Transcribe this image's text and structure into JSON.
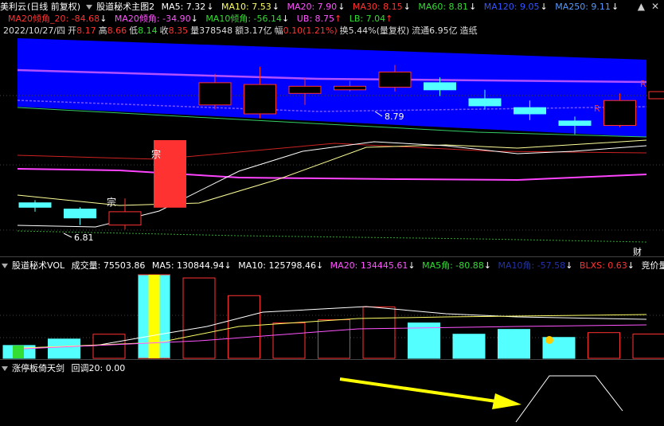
{
  "header": {
    "app": "美利云",
    "mode": "(日线 前复权)",
    "indicator": "股道秘术主图2",
    "ma5": "MA5: 7.32",
    "ma10": "MA10: 7.53",
    "ma20": "MA20: 7.90",
    "ma30": "MA30: 8.15",
    "ma60": "MA60: 8.81",
    "ma120": "MA120: 9.05",
    "ma250": "MA250: 9.11"
  },
  "header2": {
    "ma20_angle_20": "MA20倾角_20: -84.68",
    "ma20_angle": "MA20倾角: -34.90",
    "ma10_angle": "MA10倾角: -56.14",
    "ub": "UB: 8.75",
    "lb": "LB: 7.04"
  },
  "quote": {
    "date": "2022/10/27/四",
    "open_label": "开",
    "open": "8.17",
    "high_label": "高",
    "high": "8.66",
    "low_label": "低",
    "low": "8.14",
    "close_label": "收",
    "close": "8.35",
    "volume_label": "量",
    "volume": "378548",
    "amount_label": "额",
    "amount": "3.17亿",
    "change_label": "幅",
    "change": "0.10(1.21%)",
    "turnover": "换5.44%(量复权)",
    "float": "流通6.95亿",
    "sector": "造纸"
  },
  "annotations": {
    "high_mark": "8.79",
    "low_mark": "6.81",
    "zong1": "宗",
    "zong2": "宗",
    "r1": "R",
    "r2": "R",
    "cai": "财"
  },
  "vol_header": {
    "indicator": "股道秘术VOL",
    "volume": "成交量: 75503.86",
    "ma5": "MA5: 130844.94",
    "ma10": "MA10: 125798.46",
    "ma20": "MA20: 134445.61",
    "ma5_angle": "MA5角: -80.88",
    "ma10_angle": "MA10角: -57.58",
    "blxs": "BLXS: 0.63",
    "auction": "竞价量:"
  },
  "sub_header": {
    "indicator": "涨停板倚天剑",
    "pullback": "回调20: 0.00"
  },
  "colors": {
    "up": "#ff3232",
    "down": "#54ffff",
    "ma5": "#ffffff",
    "ma10": "#ffff66",
    "ma20": "#ff55ff",
    "ma60": "#33dd33",
    "band": "#0000ff",
    "ma120": "#3355ff"
  },
  "chart_data": {
    "type": "candlestick",
    "series": [
      {
        "open": 7.35,
        "close": 7.3,
        "high": 7.38,
        "low": 7.25
      },
      {
        "open": 7.28,
        "close": 7.18,
        "high": 7.3,
        "low": 7.1
      },
      {
        "open": 7.1,
        "close": 7.25,
        "high": 7.4,
        "low": 7.05
      },
      {
        "open": 7.3,
        "close": 8.05,
        "high": 8.05,
        "low": 7.3
      },
      {
        "open": 8.45,
        "close": 8.7,
        "high": 8.8,
        "low": 8.4
      },
      {
        "open": 8.35,
        "close": 8.68,
        "high": 8.88,
        "low": 8.3
      },
      {
        "open": 8.58,
        "close": 8.66,
        "high": 8.75,
        "low": 8.45
      },
      {
        "open": 8.62,
        "close": 8.66,
        "high": 8.72,
        "low": 8.6
      },
      {
        "open": 8.65,
        "close": 8.82,
        "high": 8.9,
        "low": 8.6
      },
      {
        "open": 8.7,
        "close": 8.62,
        "high": 8.76,
        "low": 8.55
      },
      {
        "open": 8.52,
        "close": 8.44,
        "high": 8.62,
        "low": 8.4
      },
      {
        "open": 8.42,
        "close": 8.35,
        "high": 8.5,
        "low": 8.28
      },
      {
        "open": 8.27,
        "close": 8.22,
        "high": 8.32,
        "low": 8.12
      },
      {
        "open": 8.22,
        "close": 8.5,
        "high": 8.58,
        "low": 8.2
      },
      {
        "open": 8.52,
        "close": 8.6,
        "high": 8.7,
        "low": 8.48
      }
    ],
    "volume": [
      40000,
      60000,
      75000,
      260000,
      250000,
      195000,
      110000,
      120000,
      160000,
      110000,
      75000,
      90000,
      65000,
      80000,
      75500
    ]
  }
}
